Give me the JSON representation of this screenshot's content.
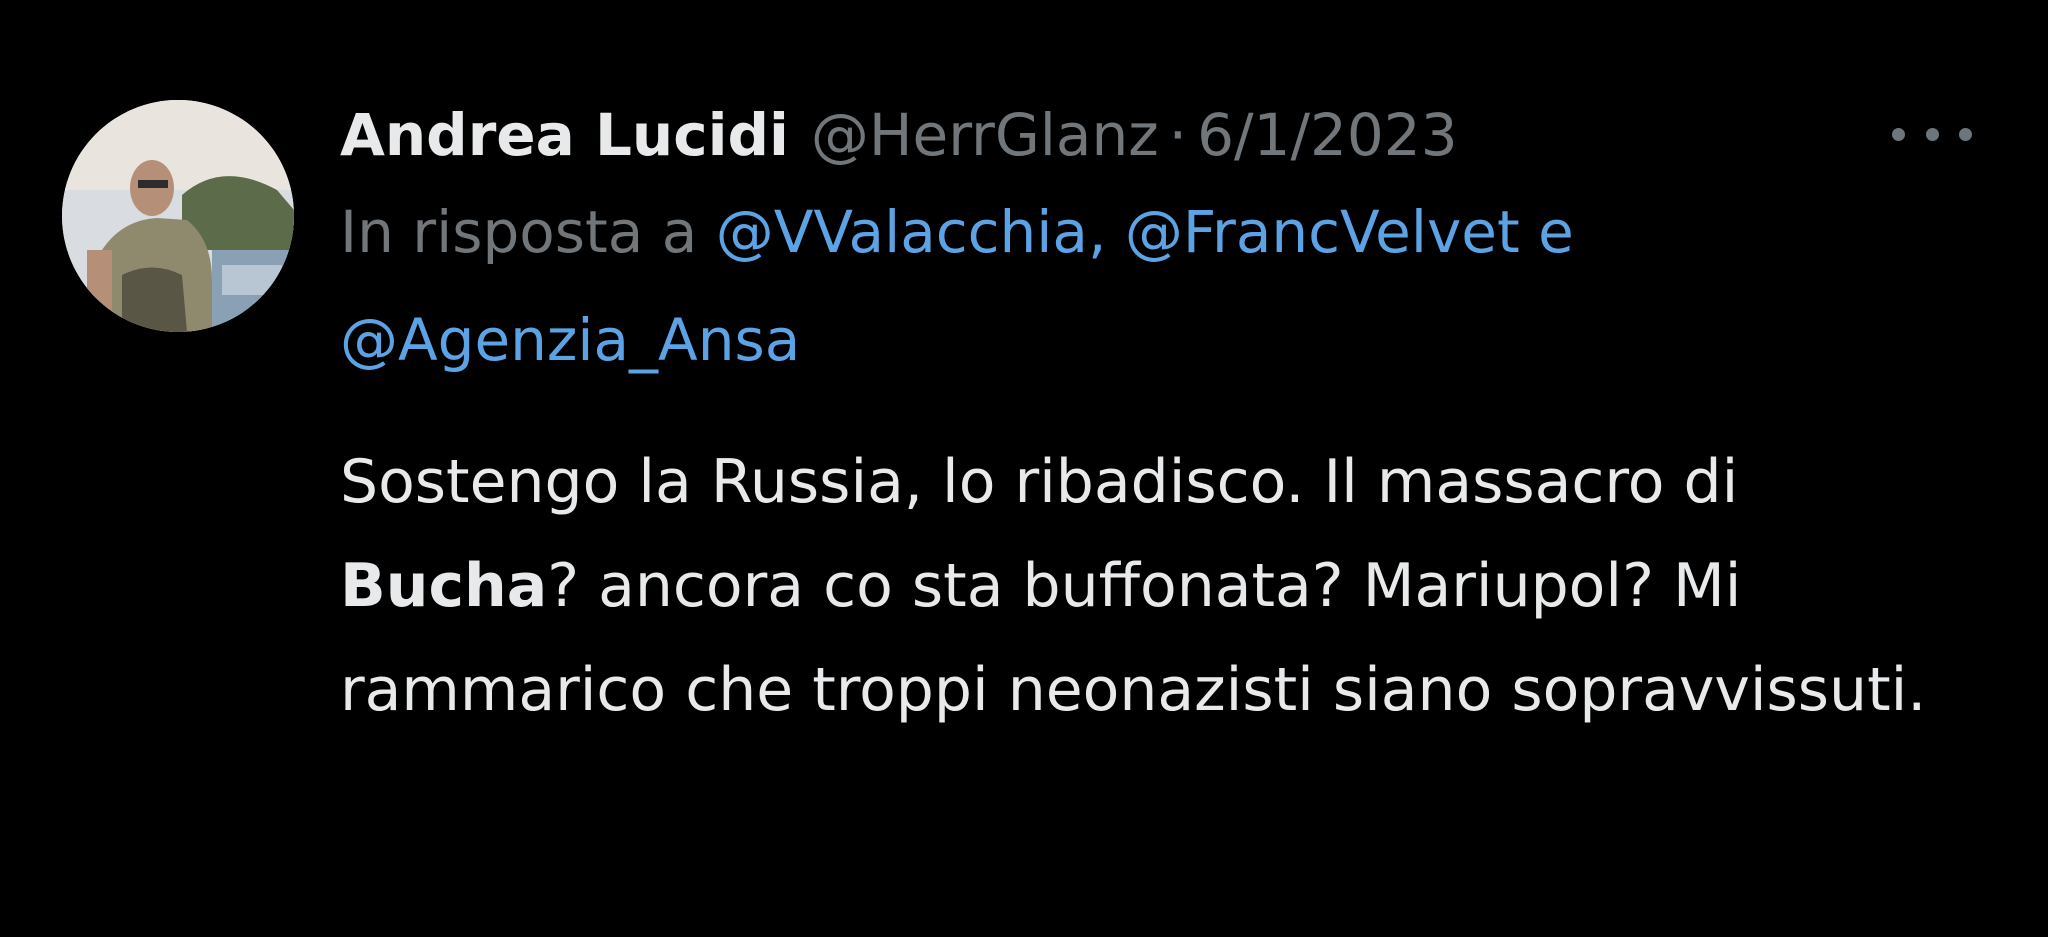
{
  "tweet": {
    "author_name": "Andrea Lucidi",
    "handle": "@HerrGlanz",
    "separator": "·",
    "date": "6/1/2023",
    "more_icon": "ellipsis-icon",
    "reply": {
      "prefix": "In risposta a",
      "mention_1": "@VValacchia,",
      "mention_2": "@FrancVelvet",
      "conjunction": "e",
      "mention_3": "@Agenzia_Ansa"
    },
    "text": {
      "part_1": "Sostengo la Russia, lo ribadisco. Il massacro di",
      "bold": "Bucha",
      "part_2": "? ancora co sta buffonata? Mariupol? Mi rammarico che troppi neonazisti siano sopravvissuti."
    }
  },
  "colors": {
    "background": "#000000",
    "primary_text": "#e7e9ea",
    "secondary_text": "#71767b",
    "mention": "#5ca3e6"
  }
}
